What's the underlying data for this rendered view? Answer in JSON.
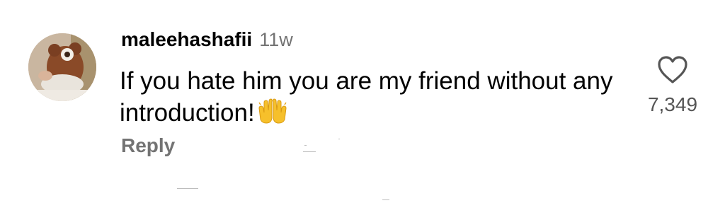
{
  "comment": {
    "username": "maleehashafii",
    "time_ago": "11w",
    "text": "If you hate him you are my friend without any introduction!",
    "emoji": "raising-hands-emoji",
    "reply_label": "Reply",
    "like_count": "7,349",
    "like_icon": "heart-outline-icon",
    "avatar_icon": "teddy-bear-avatar"
  },
  "colors": {
    "username": "#000000",
    "secondary_text": "#737373",
    "like_count": "#555555",
    "background": "#ffffff"
  }
}
